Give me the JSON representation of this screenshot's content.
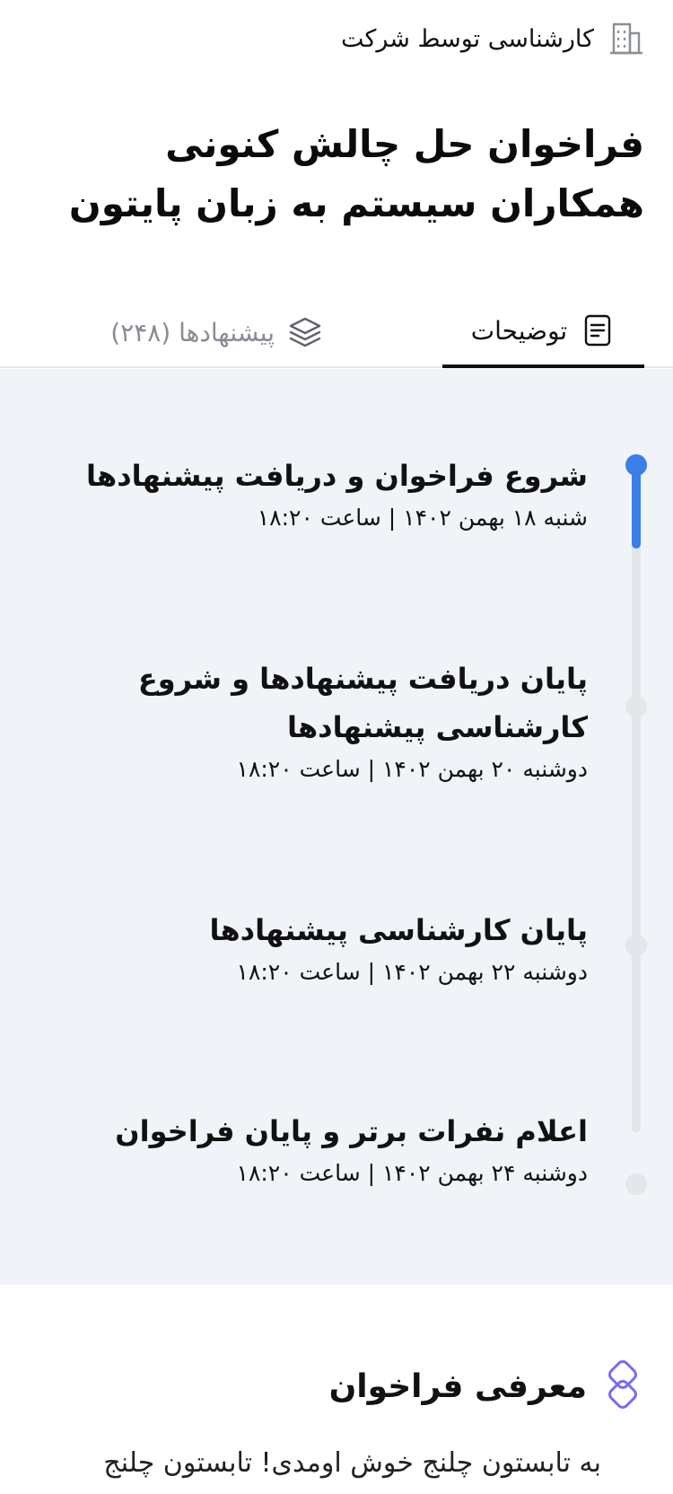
{
  "header": {
    "expert_label": "کارشناسی توسط شرکت",
    "title": "فراخوان حل چالش کنونی همکاران سیستم به زبان پایتون"
  },
  "tabs": [
    {
      "label": "توضیحات",
      "active": true,
      "icon": "document-icon"
    },
    {
      "label": "پیشنهادها (۲۴۸)",
      "active": false,
      "icon": "layers-icon"
    }
  ],
  "timeline": {
    "items": [
      {
        "title": "شروع فراخوان و دریافت پیشنهادها",
        "date": "شنبه ۱۸ بهمن ۱۴۰۲ | ساعت ۱۸:۲۰",
        "active": true
      },
      {
        "title": "پایان دریافت پیشنهادها و شروع کارشناسی پیشنهادها",
        "date": "دوشنبه ۲۰ بهمن ۱۴۰۲ | ساعت ۱۸:۲۰",
        "active": false
      },
      {
        "title": "پایان کارشناسی پیشنهادها",
        "date": "دوشنبه ۲۲ بهمن ۱۴۰۲ | ساعت ۱۸:۲۰",
        "active": false
      },
      {
        "title": "اعلام نفرات برتر و پایان فراخوان",
        "date": "دوشنبه ۲۴ بهمن ۱۴۰۲ | ساعت ۱۸:۲۰",
        "active": false
      }
    ]
  },
  "intro": {
    "title": "معرفی فراخوان",
    "text": "به تابستون چلنج خوش اومدی! تابستون چلنج"
  },
  "colors": {
    "accent": "#3a7ee8",
    "muted": "#888c94",
    "timeline_bg": "#f0f3f7",
    "brand_icon": "#7b6cf0"
  }
}
